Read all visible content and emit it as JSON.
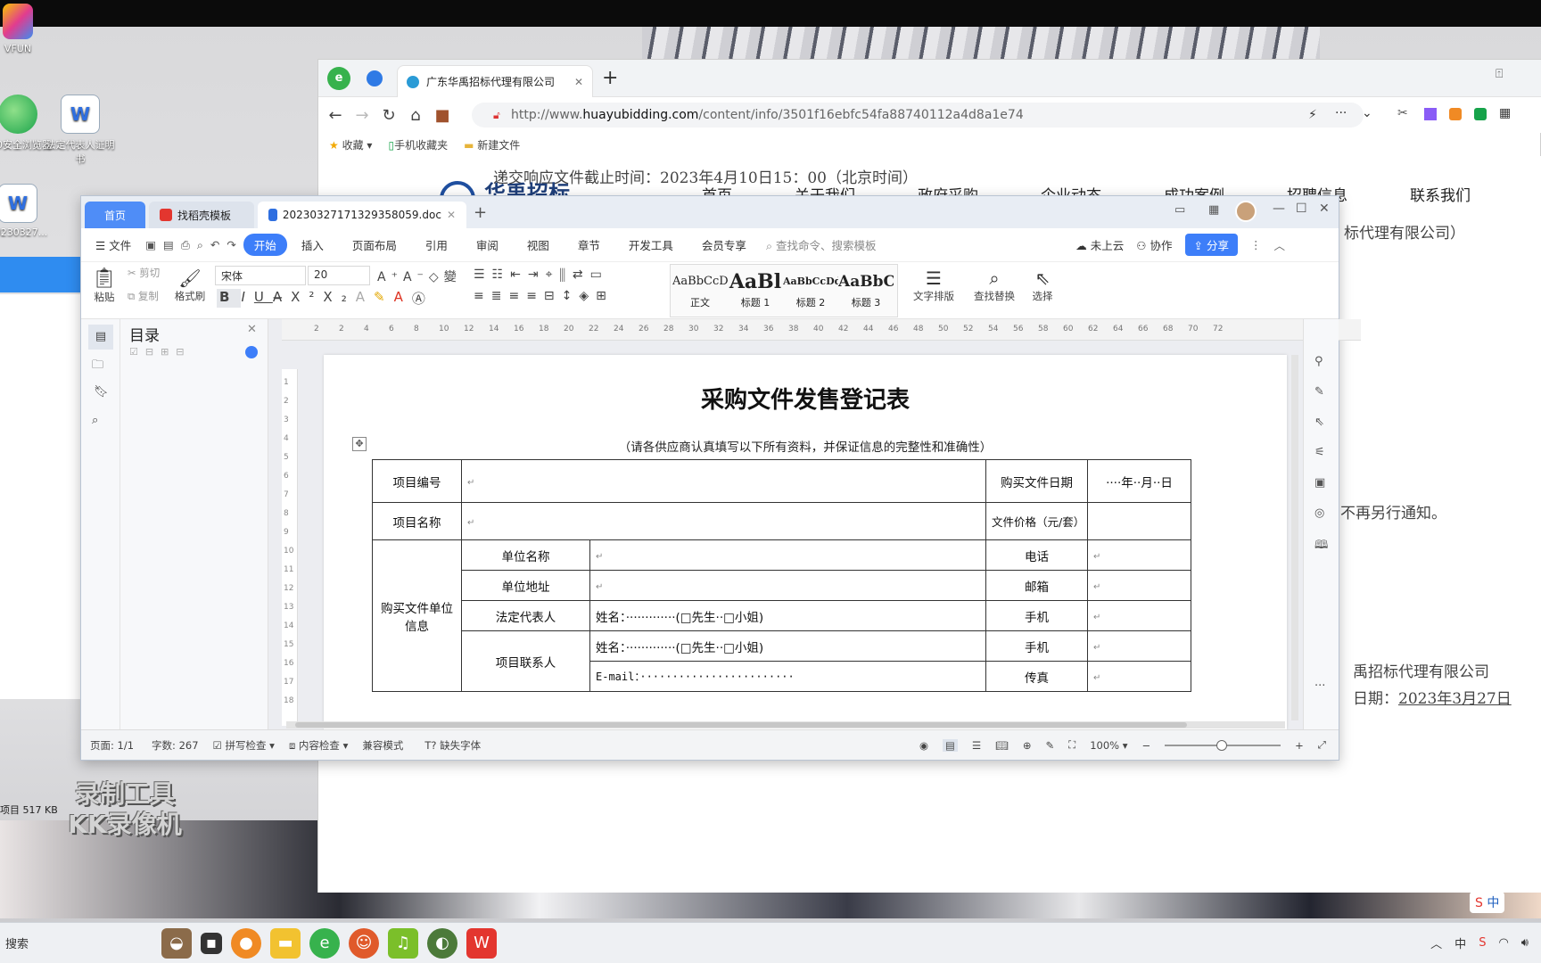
{
  "desktop": {
    "icons": [
      {
        "label": "VFUN"
      },
      {
        "label": "360安全浏览器"
      },
      {
        "label": "法定代表人证明书"
      },
      {
        "label": "20230327..."
      }
    ],
    "file_info": "项目   517 KB",
    "watermark_line1": "录制工具",
    "watermark_line2": "KK录像机"
  },
  "browser": {
    "tab_title": "广东华禹招标代理有限公司",
    "url_prefix": "http://www.",
    "url_domain": "huayubidding.com",
    "url_path": "/content/info/3501f16ebfc54fa88740112a4d8a1e74",
    "bookmarks": [
      "收藏",
      "手机收藏夹",
      "新建文件"
    ],
    "page": {
      "deadline": "递交响应文件截止时间：2023年4月10日15：00（北京时间）",
      "logo_text": "华禹招标",
      "nav": [
        "首页",
        "关于我们",
        "政府采购",
        "企业动态",
        "成功案例",
        "招聘信息",
        "联系我们"
      ],
      "company_fragment": "标代理有限公司）",
      "notice_fragment": "不再另行通知。",
      "company_sign": "禹招标代理有限公司",
      "date_prefix": "日期：",
      "date_value": "2023年3月27日"
    }
  },
  "wps": {
    "tabs": [
      {
        "label": "首页"
      },
      {
        "label": "找稻壳模板"
      },
      {
        "label": "20230327171329358059.doc"
      }
    ],
    "menu": [
      "文件",
      "开始",
      "插入",
      "页面布局",
      "引用",
      "审阅",
      "视图",
      "章节",
      "开发工具",
      "会员专享"
    ],
    "search_placeholder": "查找命令、搜索模板",
    "cloud_label": "未上云",
    "collab_label": "协作",
    "share_label": "分享",
    "ribbon": {
      "paste": "粘贴",
      "cut": "剪切",
      "copy": "复制",
      "format_painter": "格式刷",
      "font": "宋体",
      "font_size": "20",
      "styles": [
        {
          "sample": "AaBbCcDc",
          "name": "正文"
        },
        {
          "sample": "AaBl",
          "name": "标题 1"
        },
        {
          "sample": "AaBbCcDd",
          "name": "标题 2"
        },
        {
          "sample": "AaBbC",
          "name": "标题 3"
        }
      ],
      "text_layout": "文字排版",
      "find_replace": "查找替换",
      "select": "选择"
    },
    "toc_title": "目录",
    "ruler_ticks": [
      "2",
      "2",
      "4",
      "6",
      "8",
      "10",
      "12",
      "14",
      "16",
      "18",
      "20",
      "22",
      "24",
      "26",
      "28",
      "30",
      "32",
      "34",
      "36",
      "38",
      "40",
      "42",
      "44",
      "46",
      "48",
      "50",
      "52",
      "54",
      "56",
      "58",
      "60",
      "62",
      "64",
      "66",
      "68",
      "70",
      "72"
    ],
    "vruler_ticks": [
      "1",
      "2",
      "3",
      "4",
      "5",
      "6",
      "7",
      "8",
      "9",
      "10",
      "11",
      "12",
      "13",
      "14",
      "15",
      "16",
      "17",
      "18"
    ],
    "doc": {
      "title": "采购文件发售登记表",
      "subtitle": "（请各供应商认真填写以下所有资料，并保证信息的完整性和准确性）",
      "rows": {
        "project_no": "项目编号",
        "purchase_date": "购买文件日期",
        "date_fill": "····年··月··日",
        "project_name": "项目名称",
        "price": "文件价格（元/套）",
        "buyer_info": "购买文件单位信息",
        "unit_name": "单位名称",
        "phone": "电话",
        "unit_addr": "单位地址",
        "postcode": "邮箱",
        "legal_rep": "法定代表人",
        "name_fill": "姓名：·············(□先生··□小姐)",
        "mobile": "手机",
        "contact": "项目联系人",
        "email_fill": "E-mail：························",
        "fax": "传真"
      }
    },
    "status": {
      "page": "页面: 1/1",
      "words": "字数: 267",
      "spell": "拼写检查",
      "content_check": "内容检查",
      "compat": "兼容模式",
      "missing_font": "缺失字体",
      "zoom": "100%"
    }
  },
  "taskbar": {
    "search": "搜索",
    "ime": "中"
  },
  "colors": {
    "wps_accent": "#3d7ef9",
    "wps_red": "#e3362f",
    "browser_green": "#37b24d"
  }
}
